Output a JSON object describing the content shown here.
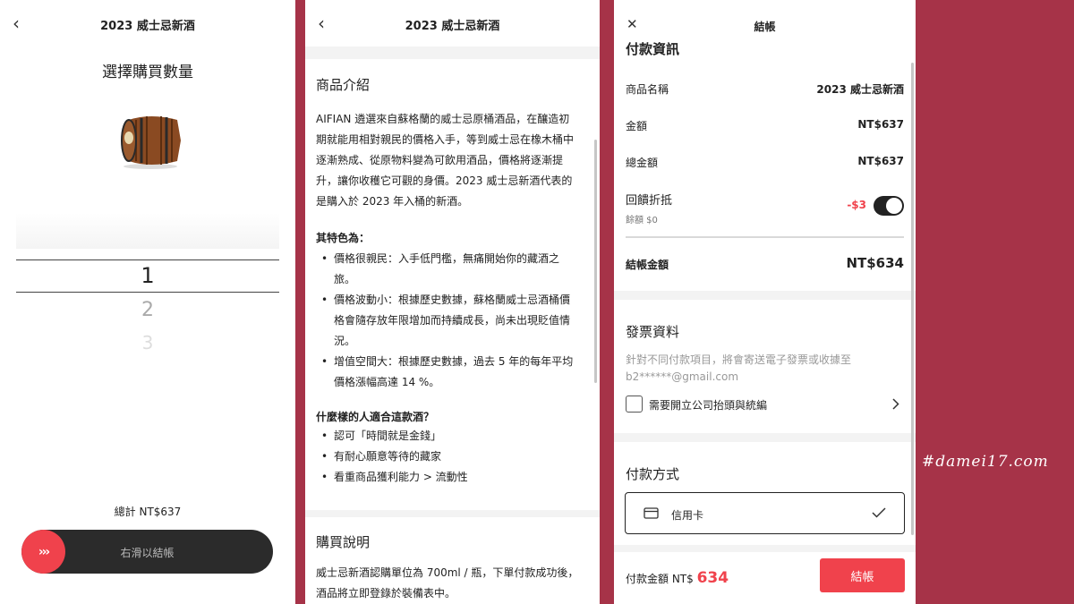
{
  "screen1": {
    "back_icon": "‹",
    "title": "2023 威士忌新酒",
    "subtitle": "選擇購買數量",
    "product_image": "whisky-barrel",
    "picker": {
      "selected": "1",
      "next": "2",
      "next2": "3"
    },
    "total_label": "總計 NT$637",
    "slide_label": "右滑以結帳",
    "slide_icon": "›››"
  },
  "screen2": {
    "back_icon": "‹",
    "title": "2023 威士忌新酒",
    "intro_title": "商品介紹",
    "intro_lines": [
      "AIFIAN 遴選來自蘇格蘭的威士忌原桶酒品，在釀造初",
      "期就能用相對親民的價格入手，等到威士忌在橡木桶中",
      "逐漸熟成、從原物料變為可飲用酒品，價格將逐漸提",
      "升，讓你收穫它可觀的身價。2023 威士忌新酒代表的",
      "是購入於 2023 年入桶的新酒。"
    ],
    "features_title": "其特色為：",
    "features": [
      [
        "價格很親民：入手低門檻，無痛開始你的藏酒之",
        "旅。"
      ],
      [
        "價格波動小：根據歷史數據，蘇格蘭威士忌酒桶價",
        "格會隨存放年限增加而持續成長，尚未出現貶值情",
        "況。"
      ],
      [
        "增值空間大：根據歷史數據，過去 5 年的每年平均",
        "價格漲幅高達 14 %。"
      ]
    ],
    "who_title": "什麼樣的人適合這款酒？",
    "who": [
      "認可「時間就是金錢」",
      "有耐心願意等待的藏家",
      "看重商品獲利能力 > 流動性"
    ],
    "purchase_title": "購買說明",
    "purchase_lines": [
      "威士忌新酒認購單位為 700ml / 瓶，下單付款成功後，",
      "酒品將立即登錄於裝備表中。"
    ]
  },
  "screen3": {
    "close_icon": "✕",
    "title": "結帳",
    "payinfo_title": "付款資訊",
    "rows": {
      "name_label": "商品名稱",
      "name_value": "2023 威士忌新酒",
      "amount_label": "金額",
      "amount_value": "NT$637",
      "total_label": "總金額",
      "total_value": "NT$637",
      "rebate_label": "回饋折抵",
      "rebate_balance": "餘額 $0",
      "rebate_value": "-$3",
      "final_label": "結帳金額",
      "final_value": "NT$634"
    },
    "rebate_toggle_on": true,
    "invoice_title": "發票資料",
    "invoice_note_1": "針對不同付款項目，將會寄送電子發票或收據至",
    "invoice_note_2": "b2******@gmail.com",
    "company_checkbox_label": "需要開立公司抬頭與統編",
    "paymethod_title": "付款方式",
    "paymethod_option": "信用卡",
    "pay_amount_label": "付款金額 NT$",
    "pay_amount_value": "634",
    "checkout_button": "結帳"
  },
  "watermark": "#damei17.com",
  "colors": {
    "accent": "#f0424c",
    "background": "#a63348",
    "dark": "#222222"
  }
}
